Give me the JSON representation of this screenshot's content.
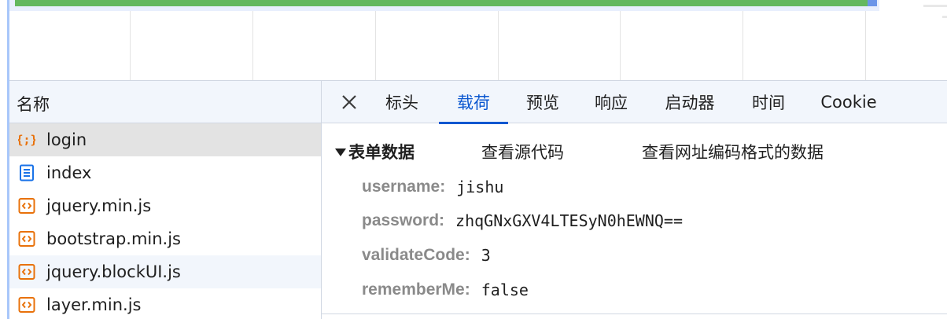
{
  "request_list": {
    "header": "名称",
    "items": [
      {
        "label": "login",
        "icon": "fetch-icon",
        "selected": true
      },
      {
        "label": "index",
        "icon": "document-icon",
        "selected": false
      },
      {
        "label": "jquery.min.js",
        "icon": "script-icon",
        "selected": false
      },
      {
        "label": "bootstrap.min.js",
        "icon": "script-icon",
        "selected": false
      },
      {
        "label": "jquery.blockUI.js",
        "icon": "script-icon",
        "selected": false
      },
      {
        "label": "layer.min.js",
        "icon": "script-icon",
        "selected": false
      }
    ]
  },
  "details": {
    "tabs": [
      {
        "label": "标头",
        "active": false
      },
      {
        "label": "载荷",
        "active": true
      },
      {
        "label": "预览",
        "active": false
      },
      {
        "label": "响应",
        "active": false
      },
      {
        "label": "启动器",
        "active": false
      },
      {
        "label": "时间",
        "active": false
      },
      {
        "label": "Cookie",
        "active": false
      }
    ],
    "section_title": "表单数据",
    "view_source_label": "查看源代码",
    "view_url_encoded_label": "查看网址编码格式的数据",
    "fields": [
      {
        "key": "username",
        "value": "jishu"
      },
      {
        "key": "password",
        "value": "zhqGNxGXV4LTESyN0hEWNQ=="
      },
      {
        "key": "validateCode",
        "value": "3"
      },
      {
        "key": "rememberMe",
        "value": "false"
      }
    ]
  },
  "colors": {
    "accent": "#0b57d0",
    "timeline_bar": "#63b85e",
    "fetch_icon": "#e8710a",
    "document_icon": "#1a73e8",
    "script_icon": "#e8710a"
  }
}
